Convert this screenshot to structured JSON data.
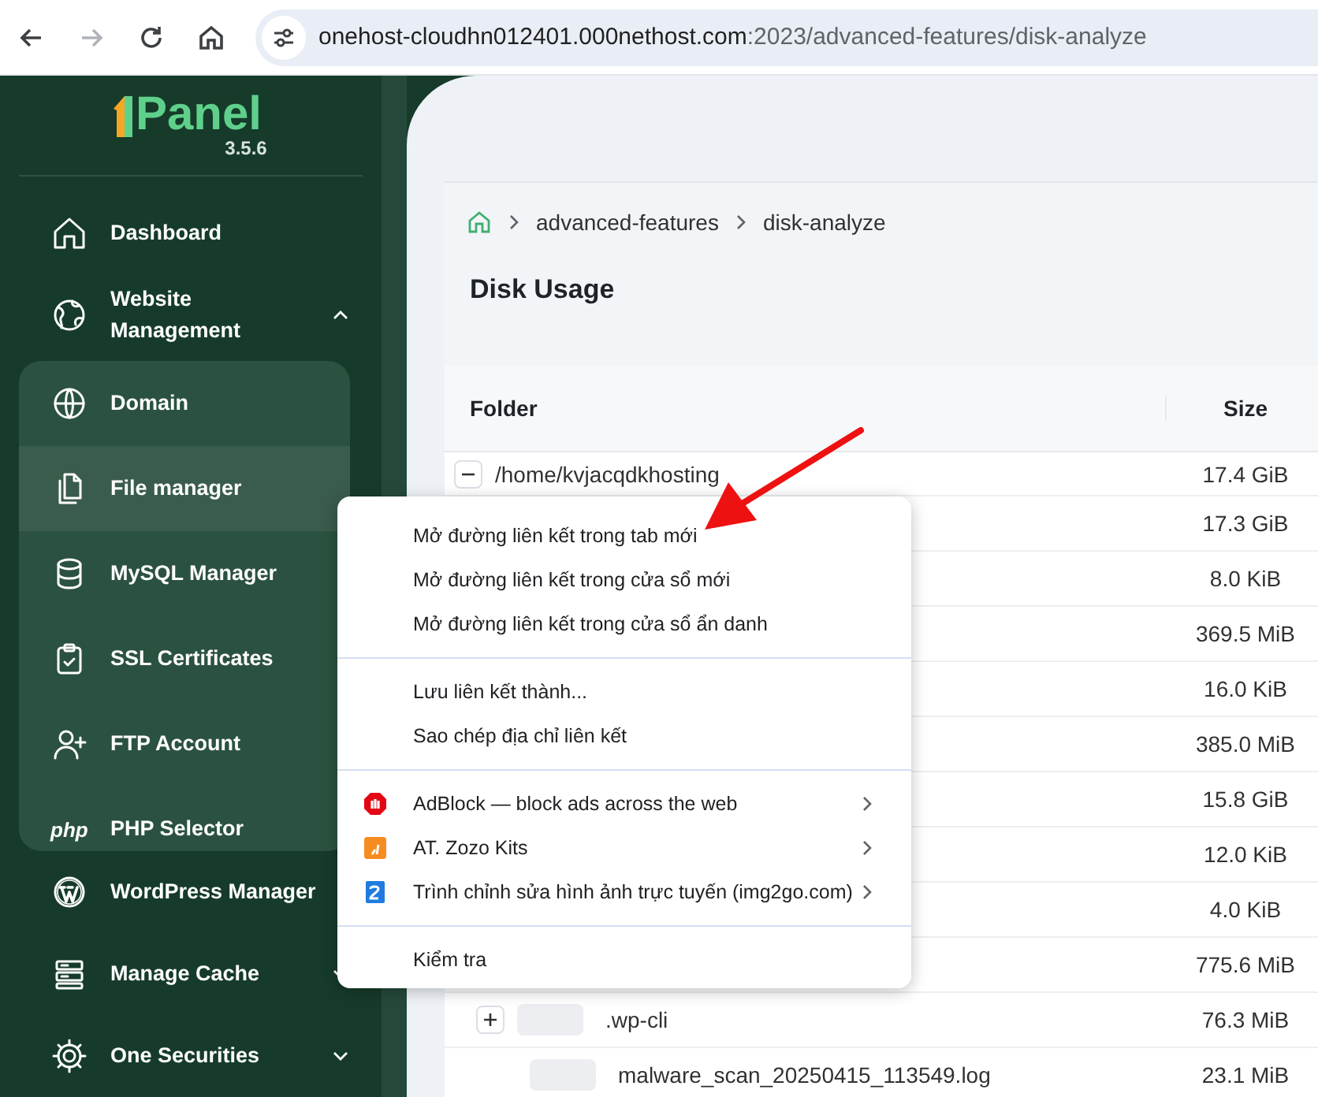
{
  "browser": {
    "back_disabled": false,
    "forward_disabled": true,
    "url_host": "onehost-cloudhn012401.000nethost.com",
    "url_path": ":2023/advanced-features/disk-analyze"
  },
  "sidebar": {
    "logo": "Panel",
    "version": "3.5.6",
    "items": [
      {
        "label": "Dashboard",
        "selected": false
      },
      {
        "label": "Website Management",
        "selected": false,
        "expanded": true,
        "children": [
          {
            "label": "Domain",
            "selected": false
          },
          {
            "label": "File manager",
            "selected": true
          },
          {
            "label": "MySQL Manager",
            "selected": false
          },
          {
            "label": "SSL Certificates",
            "selected": false
          },
          {
            "label": "FTP Account",
            "selected": false
          },
          {
            "label": "PHP Selector",
            "selected": false,
            "badge": "php"
          }
        ]
      },
      {
        "label": "WordPress Manager",
        "selected": false
      },
      {
        "label": "Manage Cache",
        "selected": false,
        "expanded": false
      },
      {
        "label": "One Securities",
        "selected": false,
        "expanded": false
      }
    ]
  },
  "breadcrumb": [
    "advanced-features",
    "disk-analyze"
  ],
  "title": "Disk Usage",
  "table": {
    "columns": [
      "Folder",
      "Size"
    ],
    "rows": [
      {
        "kind": "folder",
        "expanded": true,
        "name": "/home/kvjacqdkhosting",
        "size": "17.4 GiB"
      },
      {
        "size": "17.3 GiB"
      },
      {
        "size": "8.0 KiB"
      },
      {
        "size": "369.5 MiB"
      },
      {
        "size": "16.0 KiB"
      },
      {
        "size": "385.0 MiB"
      },
      {
        "size": "15.8 GiB"
      },
      {
        "size": "12.0 KiB"
      },
      {
        "size": "4.0 KiB"
      },
      {
        "size": "775.6 MiB"
      },
      {
        "kind": "subfolder",
        "expanded": false,
        "name": ".wp-cli",
        "size": "76.3 MiB"
      },
      {
        "kind": "file",
        "name": "malware_scan_20250415_113549.log",
        "size": "23.1 MiB"
      }
    ]
  },
  "context_menu": {
    "groups": [
      [
        {
          "kind": "item",
          "label": "Mở đường liên kết trong tab mới"
        },
        {
          "kind": "item",
          "label": "Mở đường liên kết trong cửa sổ mới"
        },
        {
          "kind": "item",
          "label": "Mở đường liên kết trong cửa sổ ẩn danh"
        }
      ],
      [
        {
          "kind": "item",
          "label": "Lưu liên kết thành..."
        },
        {
          "kind": "item",
          "label": "Sao chép địa chỉ liên kết"
        }
      ],
      [
        {
          "kind": "extension",
          "label": "AdBlock — block ads across the web"
        },
        {
          "kind": "extension",
          "label": "AT. Zozo Kits"
        },
        {
          "kind": "extension",
          "label": "Trình chỉnh sửa hình ảnh trực tuyến (img2go.com)"
        }
      ],
      [
        {
          "kind": "item",
          "label": "Kiểm tra"
        }
      ]
    ]
  }
}
